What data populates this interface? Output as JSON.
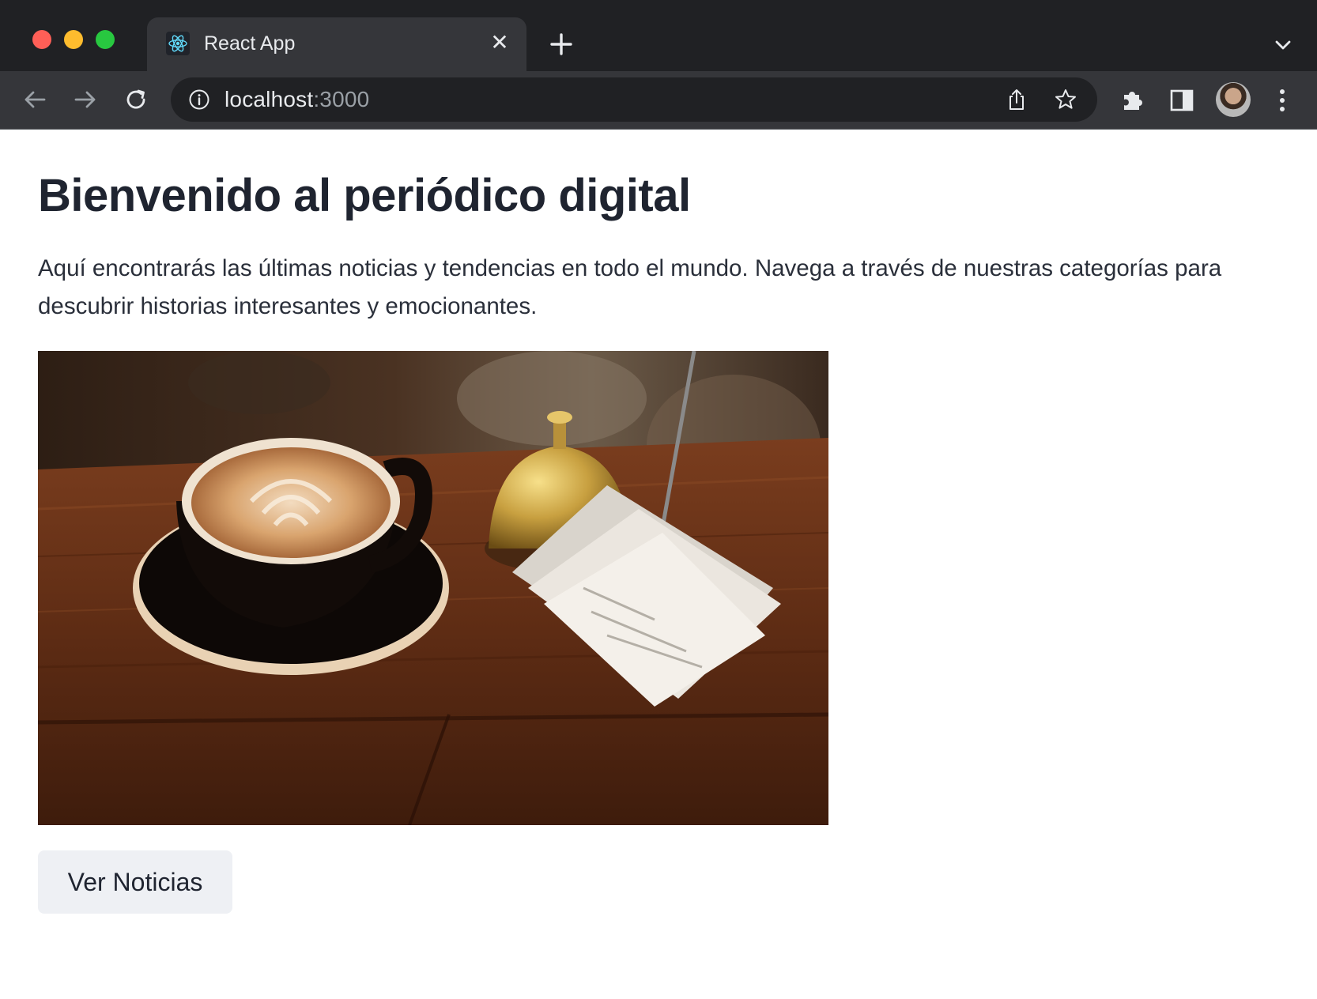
{
  "browser": {
    "tab_title": "React App",
    "tab_close_glyph": "✕",
    "url_host": "localhost",
    "url_port": ":3000",
    "icons": [
      "react-favicon",
      "close-icon",
      "plus-icon",
      "chevron-down-icon",
      "back-arrow-icon",
      "forward-arrow-icon",
      "reload-icon",
      "info-icon",
      "share-icon",
      "star-icon",
      "puzzle-icon",
      "side-panel-icon",
      "avatar",
      "kebab-menu-icon"
    ]
  },
  "page": {
    "title": "Bienvenido al periódico digital",
    "intro": "Aquí encontrarás las últimas noticias y tendencias en todo el mundo. Navega a través de nuestras categorías para descubrir historias interesantes y emocionantes.",
    "image_alt": "coffee-cup-and-bell-photo",
    "button_label": "Ver Noticias"
  },
  "colors": {
    "chrome_bg": "#202124",
    "toolbar_bg": "#35363a",
    "title_text": "#1f2430",
    "button_bg": "#eef0f4"
  }
}
